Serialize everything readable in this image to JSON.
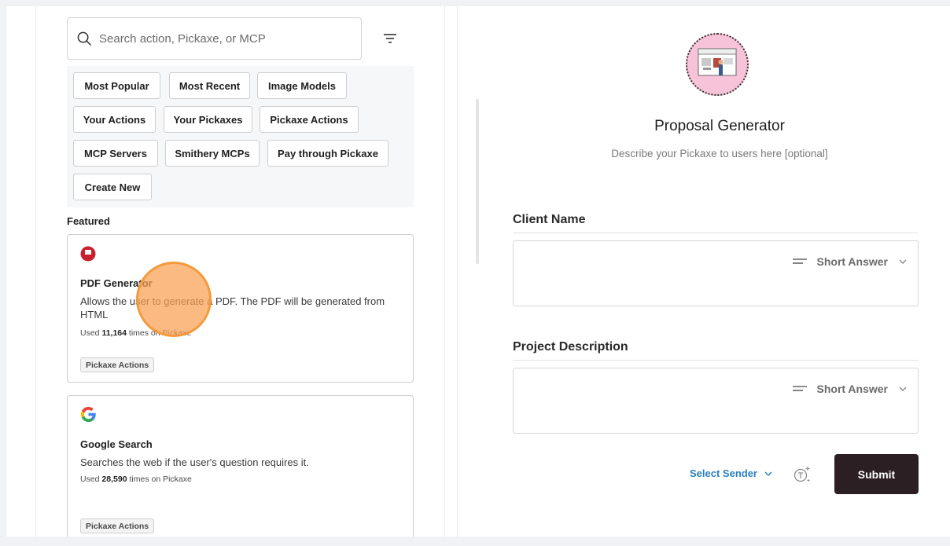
{
  "left_panel": {
    "search": {
      "placeholder": "Search action, Pickaxe, or MCP"
    },
    "chips": [
      {
        "label": "Most Popular"
      },
      {
        "label": "Most Recent"
      },
      {
        "label": "Image Models"
      },
      {
        "label": "Your Actions"
      },
      {
        "label": "Your Pickaxes"
      },
      {
        "label": "Pickaxe Actions"
      },
      {
        "label": "MCP Servers"
      },
      {
        "label": "Smithery MCPs"
      },
      {
        "label": "Pay through Pickaxe"
      },
      {
        "label": "Create New"
      }
    ],
    "featured_label": "Featured",
    "cards": [
      {
        "icon": "pdf-generator-icon",
        "title": "PDF Generator",
        "description": "Allows the user to generate a PDF. The PDF will be generated from HTML",
        "usage_prefix": "Used",
        "usage_count": "11,164",
        "usage_suffix": "times on Pickaxe",
        "tag": "Pickaxe Actions"
      },
      {
        "icon": "google-icon",
        "title": "Google Search",
        "description": "Searches the web if the user's question requires it.",
        "usage_prefix": "Used",
        "usage_count": "28,590",
        "usage_suffix": "times on Pickaxe",
        "tag": "Pickaxe Actions"
      }
    ]
  },
  "right_panel": {
    "title": "Proposal Generator",
    "description": "Describe your Pickaxe to users here [optional]",
    "fields": [
      {
        "label": "Client Name",
        "answer_type": "Short Answer"
      },
      {
        "label": "Project Description",
        "answer_type": "Short Answer"
      }
    ],
    "select_sender": "Select Sender",
    "submit_label": "Submit"
  },
  "colors": {
    "accent_link": "#2a7fc1",
    "submit_bg": "#2b1f24",
    "pdf_icon": "#c8202f",
    "cursor_halo": "#f39a3c"
  }
}
